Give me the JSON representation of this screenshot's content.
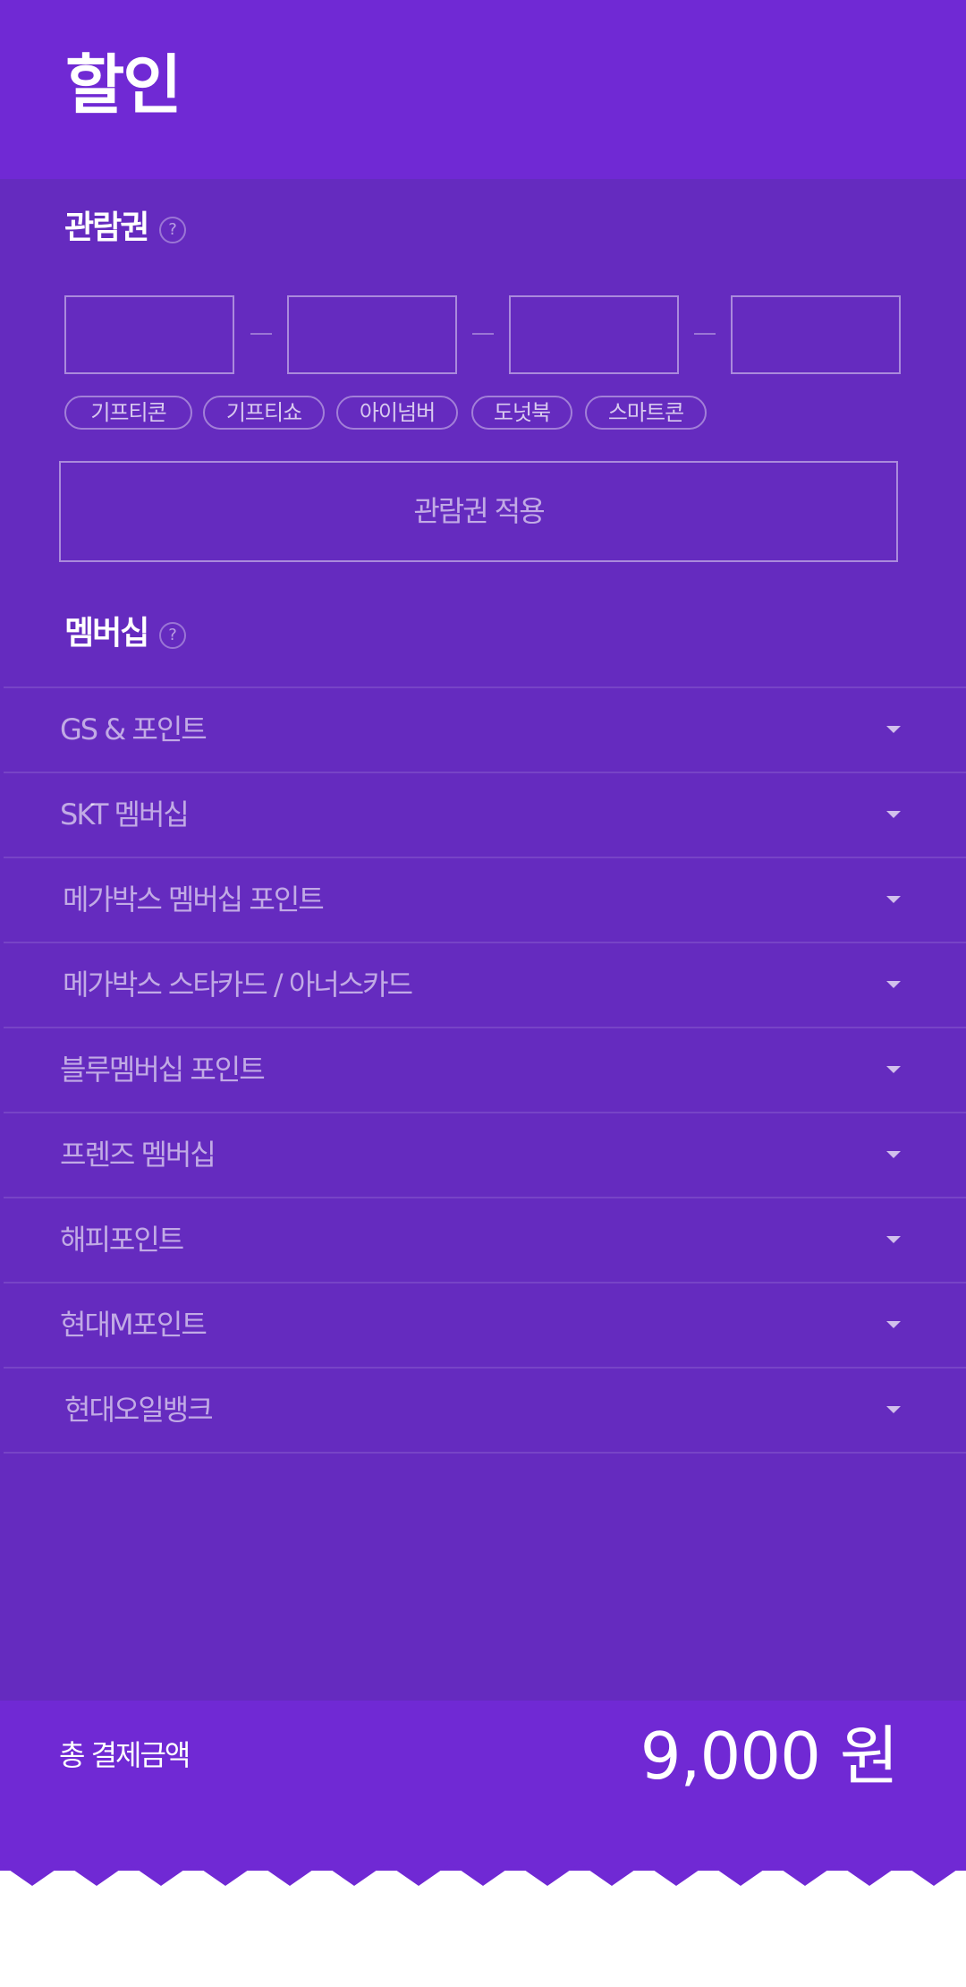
{
  "header": {
    "title": "할인"
  },
  "voucher": {
    "title": "관람권",
    "help_icon": "?",
    "input_values": [
      "",
      "",
      "",
      ""
    ],
    "chips": [
      "기프티콘",
      "기프티쇼",
      "아이넘버",
      "도넛북",
      "스마트콘"
    ],
    "apply_label": "관람권 적용"
  },
  "membership": {
    "title": "멤버십",
    "help_icon": "?",
    "items": [
      "GS & 포인트",
      "SKT 멤버십",
      "메가박스 멤버십 포인트",
      "메가박스 스타카드 / 아너스카드",
      "블루멤버십 포인트",
      "프렌즈 멤버십",
      "해피포인트",
      "현대M포인트",
      "현대오일뱅크"
    ]
  },
  "footer": {
    "total_label": "총 결제금액",
    "total_amount": "9,000 원"
  },
  "colors": {
    "header": "#7029d4",
    "content": "#652bbf",
    "footer": "#7029d4",
    "receipt_bottom": "#ffffff"
  }
}
